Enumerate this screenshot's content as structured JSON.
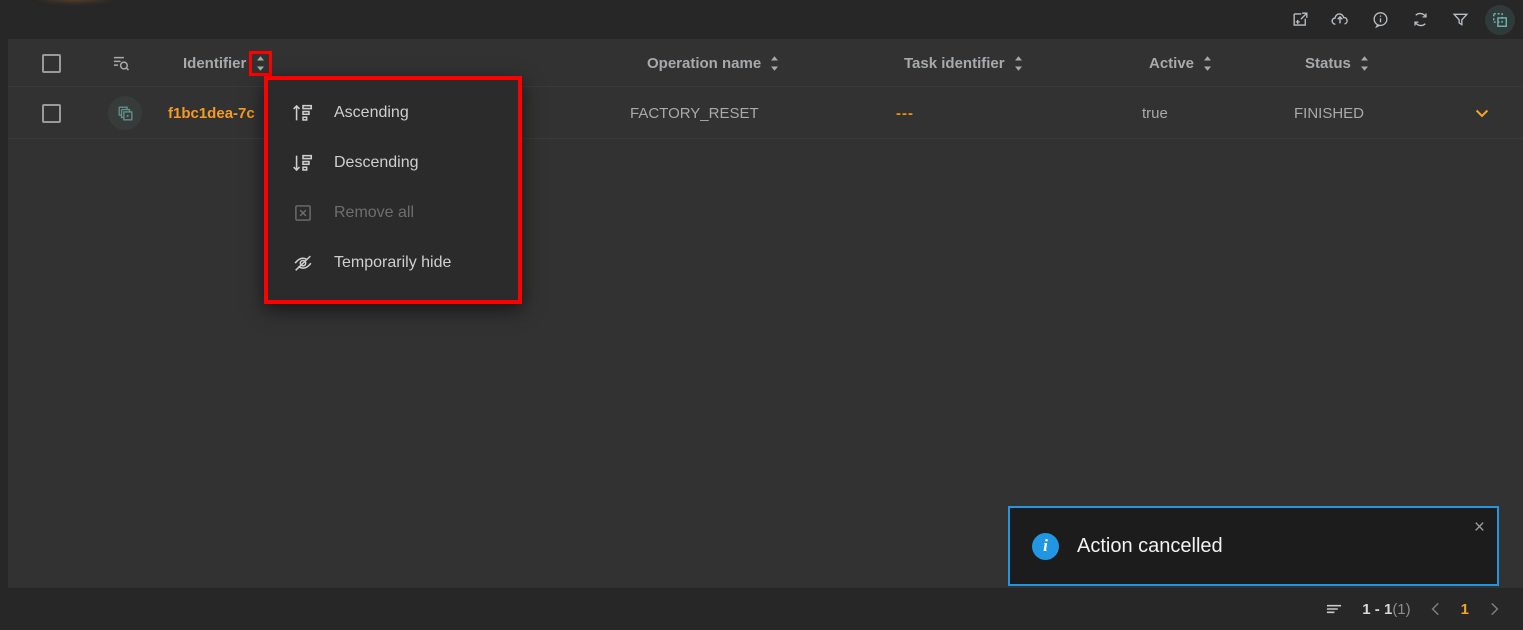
{
  "toolbar": {
    "icons": [
      {
        "name": "export-window-icon",
        "title": "Export"
      },
      {
        "name": "cloud-upload-icon",
        "title": "Upload"
      },
      {
        "name": "info-circle-icon",
        "title": "Info"
      },
      {
        "name": "refresh-icon",
        "title": "Refresh"
      },
      {
        "name": "filter-icon",
        "title": "Filter"
      },
      {
        "name": "select-columns-icon",
        "title": "Columns"
      }
    ],
    "active_icon_color": "#6fb5ae"
  },
  "table": {
    "search_icon": "list-search-icon",
    "columns": [
      {
        "label": "Identifier",
        "sortable": true,
        "highlighted": true
      },
      {
        "label": "Operation name",
        "sortable": true,
        "highlighted": false
      },
      {
        "label": "Task identifier",
        "sortable": true,
        "highlighted": false
      },
      {
        "label": "Active",
        "sortable": true,
        "highlighted": false
      },
      {
        "label": "Status",
        "sortable": true,
        "highlighted": false
      }
    ],
    "rows": [
      {
        "identifier": "f1bc1dea-7c",
        "operation_name": "FACTORY_RESET",
        "task_identifier": "---",
        "active": "true",
        "status": "FINISHED",
        "row_icon": "copy-stack-icon",
        "expand_icon": "chevron-down-icon"
      }
    ]
  },
  "sort_menu": {
    "items": [
      {
        "label": "Ascending",
        "icon": "sort-ascending-icon",
        "disabled": false
      },
      {
        "label": "Descending",
        "icon": "sort-descending-icon",
        "disabled": false
      },
      {
        "label": "Remove all",
        "icon": "remove-all-icon",
        "disabled": true
      },
      {
        "label": "Temporarily hide",
        "icon": "eye-off-icon",
        "disabled": false
      }
    ],
    "border_color": "#ff0000"
  },
  "toast": {
    "message": "Action cancelled",
    "icon": "info-circle-icon",
    "close_label": "×",
    "accent_color": "#2196e3"
  },
  "pagination": {
    "rows_icon": "rows-per-page-icon",
    "range": "1 - 1",
    "total": "(1)",
    "prev_icon": "chevron-left-icon",
    "current_page": "1",
    "next_icon": "chevron-right-icon",
    "accent_color": "#f5a524"
  }
}
